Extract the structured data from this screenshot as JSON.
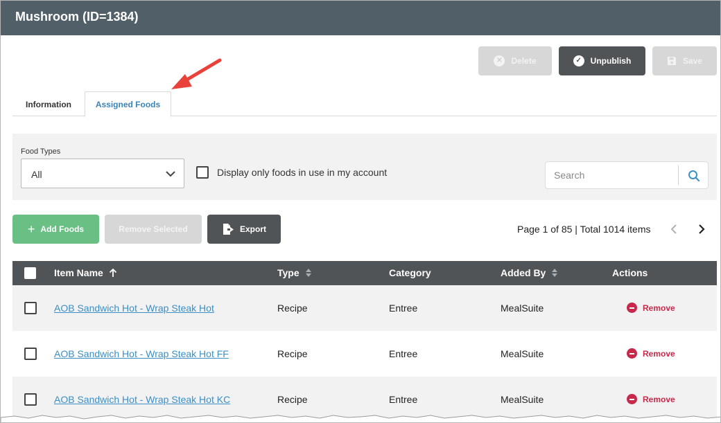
{
  "header": {
    "title": "Mushroom (ID=1384)"
  },
  "toolbar": {
    "delete_label": "Delete",
    "unpublish_label": "Unpublish",
    "save_label": "Save"
  },
  "tabs": [
    {
      "label": "Information",
      "active": false
    },
    {
      "label": "Assigned Foods",
      "active": true
    }
  ],
  "filters": {
    "food_types_label": "Food Types",
    "food_types_value": "All",
    "display_only_label": "Display only foods in use in my account",
    "search_placeholder": "Search"
  },
  "actions": {
    "add_label": "Add Foods",
    "remove_selected_label": "Remove Selected",
    "export_label": "Export"
  },
  "pager": {
    "text": "Page 1 of 85 | Total 1014 items"
  },
  "table": {
    "columns": [
      "Item Name",
      "Type",
      "Category",
      "Added By",
      "Actions"
    ],
    "rows": [
      {
        "name": "AOB Sandwich Hot - Wrap Steak Hot",
        "type": "Recipe",
        "category": "Entree",
        "added_by": "MealSuite",
        "action": "Remove"
      },
      {
        "name": "AOB Sandwich Hot - Wrap Steak Hot FF",
        "type": "Recipe",
        "category": "Entree",
        "added_by": "MealSuite",
        "action": "Remove"
      },
      {
        "name": "AOB Sandwich Hot - Wrap Steak Hot KC",
        "type": "Recipe",
        "category": "Entree",
        "added_by": "MealSuite",
        "action": "Remove"
      }
    ]
  },
  "colors": {
    "header_bg": "#515f69",
    "dark_button": "#515456",
    "disabled_button": "#d7d7d7",
    "add_button": "#6abf85",
    "link": "#3b8fc4",
    "remove_red": "#c8294b",
    "tab_active_text": "#3b84b8",
    "annotation_arrow": "#e8423a"
  },
  "icons": {
    "delete": "x-circle-icon",
    "unpublish": "check-circle-icon",
    "save": "floppy-disk-icon",
    "add": "plus-icon",
    "export": "file-export-icon",
    "search": "search-icon",
    "sort_asc": "arrow-up-icon",
    "sort": "sort-icon",
    "remove": "minus-circle-icon"
  }
}
